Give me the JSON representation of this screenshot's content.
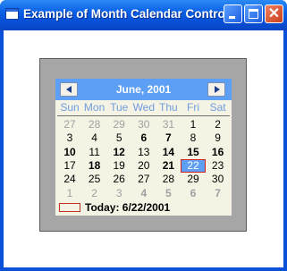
{
  "window": {
    "title": "Example of Month Calendar Control",
    "controls": {
      "minimize": "minimize",
      "maximize": "maximize",
      "close": "✕"
    }
  },
  "calendar": {
    "month_title": "June, 2001",
    "days_of_week": [
      "Sun",
      "Mon",
      "Tue",
      "Wed",
      "Thu",
      "Fri",
      "Sat"
    ],
    "weeks": [
      [
        {
          "d": "27",
          "muted": true,
          "bold": false
        },
        {
          "d": "28",
          "muted": true,
          "bold": false
        },
        {
          "d": "29",
          "muted": true,
          "bold": false
        },
        {
          "d": "30",
          "muted": true,
          "bold": false
        },
        {
          "d": "31",
          "muted": true,
          "bold": false
        },
        {
          "d": "1",
          "muted": false,
          "bold": false
        },
        {
          "d": "2",
          "muted": false,
          "bold": false
        }
      ],
      [
        {
          "d": "3",
          "muted": false,
          "bold": false
        },
        {
          "d": "4",
          "muted": false,
          "bold": false
        },
        {
          "d": "5",
          "muted": false,
          "bold": false
        },
        {
          "d": "6",
          "muted": false,
          "bold": true
        },
        {
          "d": "7",
          "muted": false,
          "bold": true
        },
        {
          "d": "8",
          "muted": false,
          "bold": false
        },
        {
          "d": "9",
          "muted": false,
          "bold": false
        }
      ],
      [
        {
          "d": "10",
          "muted": false,
          "bold": true
        },
        {
          "d": "11",
          "muted": false,
          "bold": false
        },
        {
          "d": "12",
          "muted": false,
          "bold": true
        },
        {
          "d": "13",
          "muted": false,
          "bold": false
        },
        {
          "d": "14",
          "muted": false,
          "bold": true
        },
        {
          "d": "15",
          "muted": false,
          "bold": true
        },
        {
          "d": "16",
          "muted": false,
          "bold": true
        }
      ],
      [
        {
          "d": "17",
          "muted": false,
          "bold": false
        },
        {
          "d": "18",
          "muted": false,
          "bold": true
        },
        {
          "d": "19",
          "muted": false,
          "bold": false
        },
        {
          "d": "20",
          "muted": false,
          "bold": false
        },
        {
          "d": "21",
          "muted": false,
          "bold": true
        },
        {
          "d": "22",
          "muted": false,
          "bold": false,
          "selected": true
        },
        {
          "d": "23",
          "muted": false,
          "bold": false
        }
      ],
      [
        {
          "d": "24",
          "muted": false,
          "bold": false
        },
        {
          "d": "25",
          "muted": false,
          "bold": false
        },
        {
          "d": "26",
          "muted": false,
          "bold": false
        },
        {
          "d": "27",
          "muted": false,
          "bold": false
        },
        {
          "d": "28",
          "muted": false,
          "bold": false
        },
        {
          "d": "29",
          "muted": false,
          "bold": false
        },
        {
          "d": "30",
          "muted": false,
          "bold": false
        }
      ],
      [
        {
          "d": "1",
          "muted": true,
          "bold": false
        },
        {
          "d": "2",
          "muted": true,
          "bold": false
        },
        {
          "d": "3",
          "muted": true,
          "bold": false
        },
        {
          "d": "4",
          "muted": true,
          "bold": true
        },
        {
          "d": "5",
          "muted": true,
          "bold": true
        },
        {
          "d": "6",
          "muted": true,
          "bold": true
        },
        {
          "d": "7",
          "muted": true,
          "bold": true
        }
      ]
    ],
    "today_label": "Today: 6/22/2001"
  },
  "colors": {
    "titlebar": "#0a5fe6",
    "calendar_header": "#5c9ff4",
    "calendar_background": "#f5f3e4",
    "panel_background": "#a6a6a6",
    "day_of_week_text": "#6e9de0",
    "muted_day_text": "#a0a0a0",
    "today_marker": "#c03020"
  }
}
